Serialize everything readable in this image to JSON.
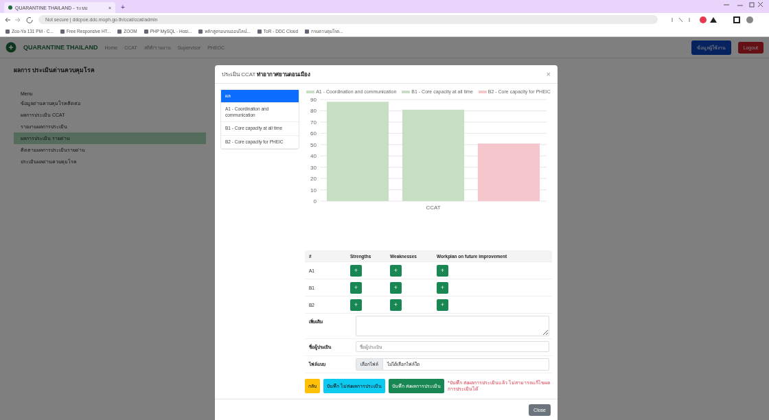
{
  "browser": {
    "tab_title": "QUARANTINE THAILAND - ระบบ",
    "tab_close": "×",
    "new_tab": "+",
    "address": "Not secure | ddcpoe.ddc.moph.go.th/ccat/ccat/admin",
    "bookmarks": [
      "Zoo-Ya 131 PM - C...",
      "Free Responsive HT...",
      "ZOOM",
      "PHP MySQL - Hosi...",
      "หลักสูตรอบรมออนไลน์...",
      "ToR - DDC Cloud",
      "กรมควบคุมโรค..."
    ]
  },
  "navbar": {
    "brand": "QUARANTINE THAILAND",
    "links": [
      "Home",
      "CCAT",
      "สถิติ/รายงาน",
      "Supervisor",
      "PHEOC"
    ],
    "user_button": "ข้อมูลผู้ใช้งาน",
    "logout_button": "Logout"
  },
  "sidebar": {
    "heading": "ผลการ ประเมินด่านควบคุมโรค",
    "menu_title": "Menu",
    "items": [
      {
        "label": "ข้อมูลด่านควบคุมโรคติดต่อ",
        "selected": false
      },
      {
        "label": "ผลการประเมิน CCAT",
        "selected": false
      },
      {
        "label": "รายงานผลการประเมิน",
        "selected": false
      },
      {
        "label": "ผลการประเมิน รายด่าน",
        "selected": true
      },
      {
        "label": "ติดตามผลการประเมินรายด่าน",
        "selected": false
      },
      {
        "label": "ประเมินผลด่านควบคุมโรค",
        "selected": false
      }
    ]
  },
  "modal": {
    "title_prefix": "ประเมิน CCAT",
    "title": "ท่าอากาศยานดอนเมือง",
    "close": "×",
    "tabs": [
      {
        "label": "ผล",
        "selected": true
      },
      {
        "label": "A1 - Coordination and communication",
        "selected": false
      },
      {
        "label": "B1 - Core capacity at all time",
        "selected": false
      },
      {
        "label": "B2 - Core capacity for PHEIC",
        "selected": false
      }
    ],
    "chart_data": {
      "type": "bar",
      "categories": [
        "CCAT"
      ],
      "series": [
        {
          "name": "A1 - Coordination and communication",
          "color": "#c8dfc6",
          "values": [
            88
          ]
        },
        {
          "name": "B1 - Core capacity at all time",
          "color": "#c8dfc6",
          "values": [
            81
          ]
        },
        {
          "name": "B2 - Core capacity for PHEIC",
          "color": "#f5c6cc",
          "values": [
            51
          ]
        }
      ],
      "ylim": [
        0,
        90
      ],
      "grid": true,
      "yticks": [
        0,
        10,
        20,
        30,
        40,
        50,
        60,
        70,
        80,
        90
      ]
    },
    "table": {
      "columns": [
        "#",
        "Strengths",
        "Weaknesses",
        "Workplan on future improvement"
      ],
      "rows": [
        {
          "label": "A1",
          "add": "+"
        },
        {
          "label": "B1",
          "add": "+"
        },
        {
          "label": "B2",
          "add": "+"
        }
      ]
    },
    "note_label": "เพิ่มเติม",
    "assessor_label": "ชื่อผู้ประเมิน",
    "assessor_placeholder": "ชื่อผู้ประเมิน",
    "file_label": "ไฟล์แนบ",
    "file_button": "เลือกไฟล์",
    "file_status": "ไม่ได้เลือกไฟล์ใด",
    "buttons": [
      {
        "label": "กลับ",
        "kind": "warning"
      },
      {
        "label": "บันทึก ไม่ส่งผลการประเมิน",
        "kind": "info"
      },
      {
        "label": "บันทึก ส่งผลการประเมิน",
        "kind": "success"
      }
    ],
    "warning_text": "*บันทึก ส่งผลการประเมินแล้ว ไม่สามารถแก้ไขผลการประเมินได้",
    "footer_button": "Close"
  }
}
